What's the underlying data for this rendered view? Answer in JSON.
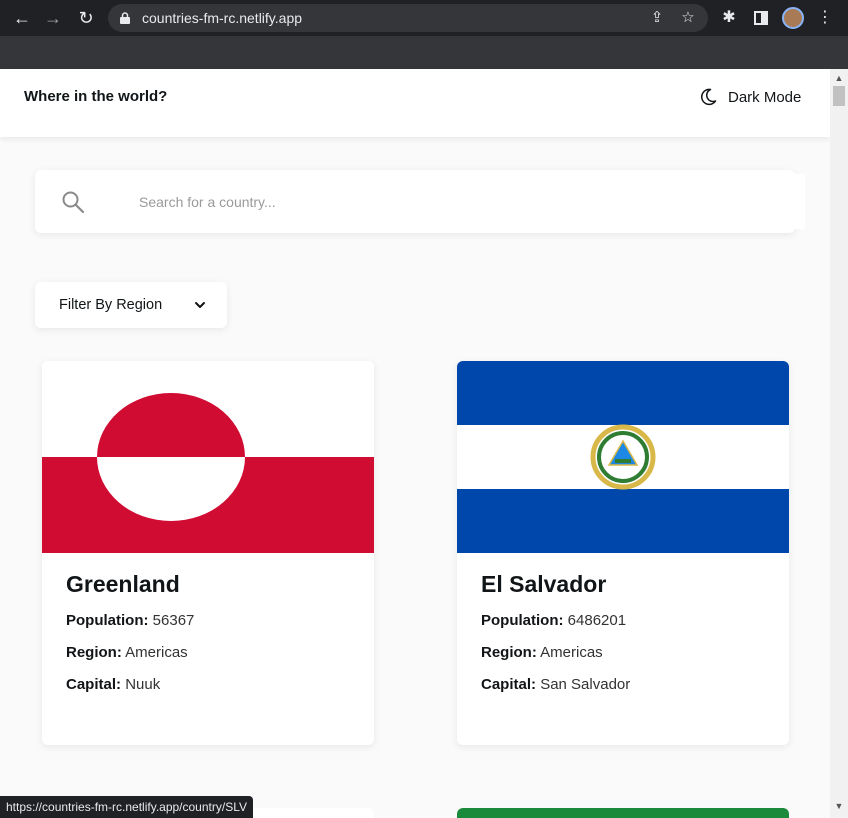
{
  "browser": {
    "url": "countries-fm-rc.netlify.app",
    "status_url": "https://countries-fm-rc.netlify.app/country/SLV"
  },
  "header": {
    "title": "Where in the world?",
    "dark_mode_label": "Dark Mode"
  },
  "search": {
    "placeholder": "Search for a country...",
    "value": ""
  },
  "filter": {
    "label": "Filter By Region"
  },
  "cards": [
    {
      "name": "Greenland",
      "population_label": "Population:",
      "population": "56367",
      "region_label": "Region:",
      "region": "Americas",
      "capital_label": "Capital:",
      "capital": "Nuuk",
      "flag": "greenland-flag"
    },
    {
      "name": "El Salvador",
      "population_label": "Population:",
      "population": "6486201",
      "region_label": "Region:",
      "region": "Americas",
      "capital_label": "Capital:",
      "capital": "San Salvador",
      "flag": "el-salvador-flag"
    }
  ],
  "colors": {
    "greenland_red": "#d00c33",
    "salvador_blue": "#0047ab",
    "background": "#fafafa"
  }
}
